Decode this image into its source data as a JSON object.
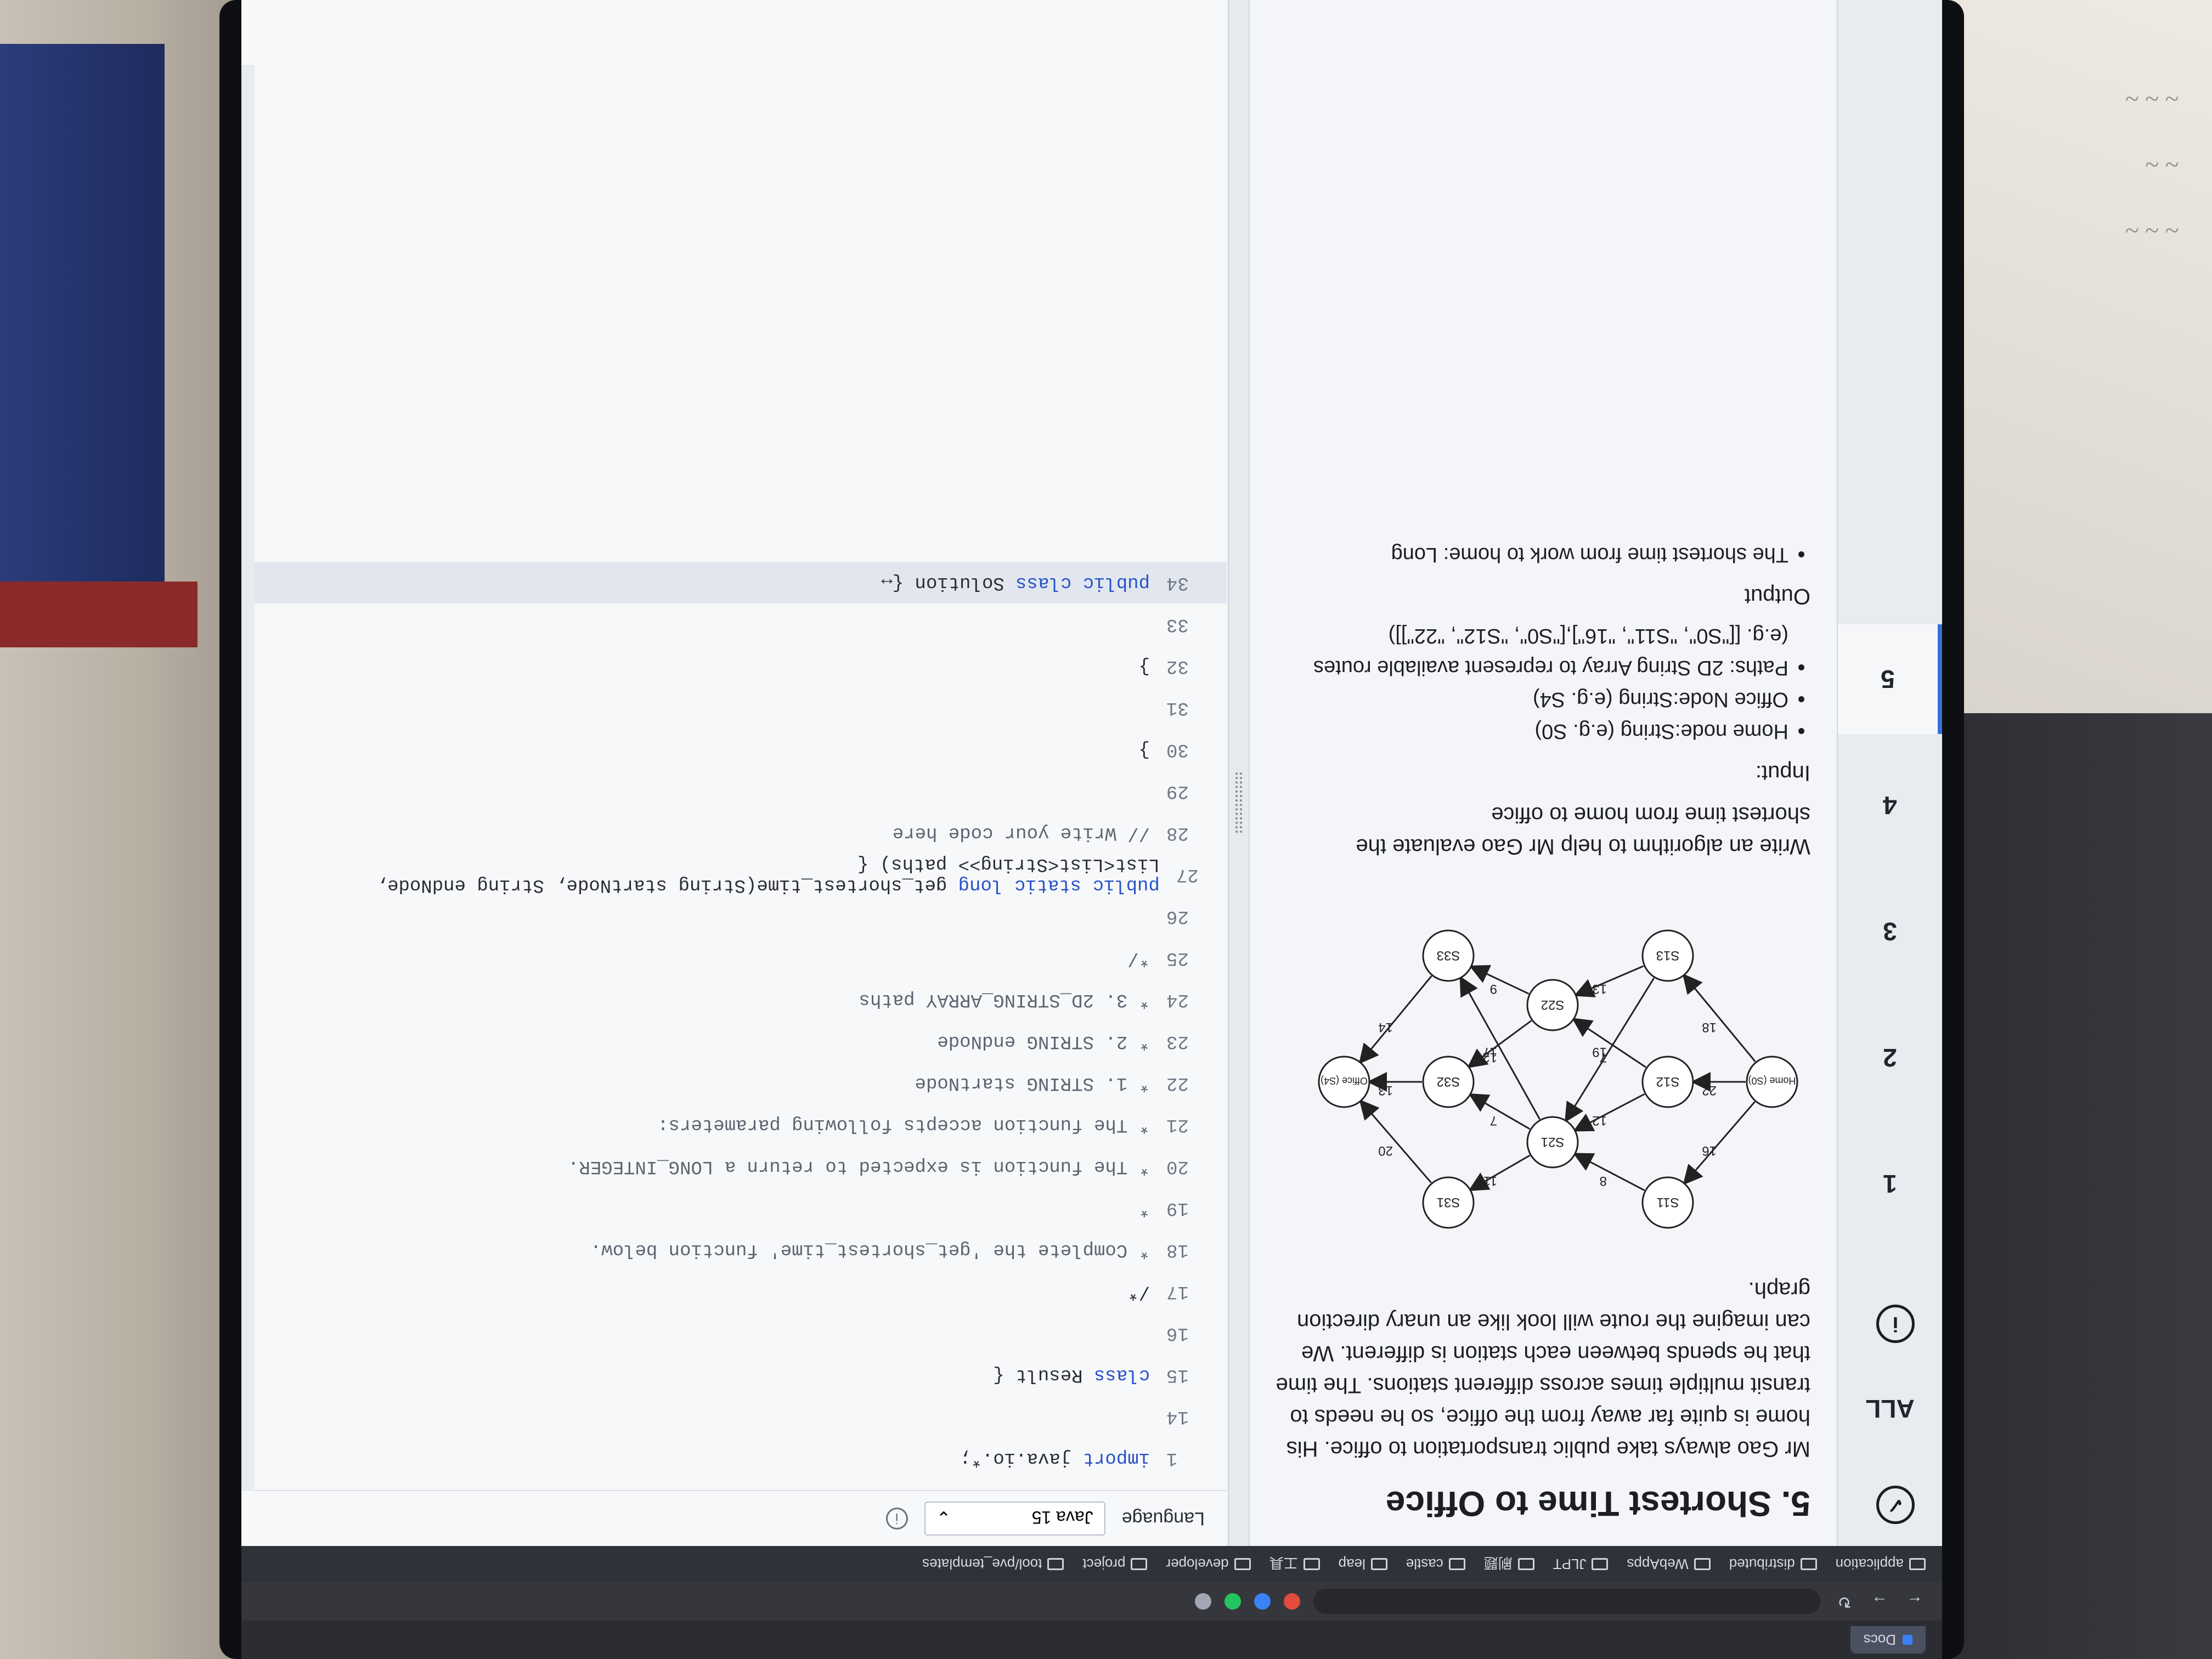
{
  "browser": {
    "tabs": [
      "Docs"
    ],
    "url": "",
    "bookmarks": [
      "application",
      "distributed",
      "WebApps",
      "JLPT",
      "刷题",
      "castle",
      "leap",
      "工具",
      "developer",
      "project",
      "tool/pve_templates"
    ]
  },
  "nav": {
    "all_label": "ALL",
    "info_icon": "i",
    "items": [
      "1",
      "2",
      "3",
      "4",
      "5"
    ],
    "selected": "5"
  },
  "question": {
    "title": "5. Shortest Time to Office",
    "intro": "Mr Gao always take public transportation to office. His home is quite far away from the office, so he needs to transit multiple times across different stations. The time that he spends between each station is different. We can imagine the route will look like an unary direction graph.",
    "task": "Write an algorithm to help Mr Gao evaluate the shortest time from home to office",
    "input_label": "Input:",
    "inputs": [
      "Home node:String (e.g. S0)",
      "Office Node:String (e.g. S4)",
      "Paths: 2D String Array to represent available routes (e.g. [[\"S0\", \"S11\", \"16\"],[\"S0\", \"S12\", \"22\"]])"
    ],
    "output_label": "Output",
    "outputs": [
      "The shortest time from work to home: Long"
    ]
  },
  "graph": {
    "nodes": [
      "Home (S0)",
      "S11",
      "S12",
      "S13",
      "S21",
      "S22",
      "S31",
      "S32",
      "S33",
      "Office (S4)"
    ],
    "edge_labels": [
      "16",
      "22",
      "18",
      "8",
      "12",
      "19",
      "13",
      "11",
      "7",
      "17",
      "9",
      "12",
      "20",
      "13",
      "14",
      "7"
    ]
  },
  "editor": {
    "language_label": "Language",
    "language_value": "Java 15",
    "lines": [
      {
        "n": "1",
        "html": "<span class='kw'>import</span> java.io.*;"
      },
      {
        "n": "14",
        "html": ""
      },
      {
        "n": "15",
        "html": "<span class='kw'>class</span> Result {"
      },
      {
        "n": "16",
        "html": ""
      },
      {
        "n": "17",
        "html": "    /*"
      },
      {
        "n": "18",
        "html": "<span class='cm'>     * Complete the 'get_shortest_time' function below.</span>"
      },
      {
        "n": "19",
        "html": "<span class='cm'>     *</span>"
      },
      {
        "n": "20",
        "html": "<span class='cm'>     * The function is expected to return a LONG_INTEGER.</span>"
      },
      {
        "n": "21",
        "html": "<span class='cm'>     * The function accepts following parameters:</span>"
      },
      {
        "n": "22",
        "html": "<span class='cm'>     *  1. STRING startNode</span>"
      },
      {
        "n": "23",
        "html": "<span class='cm'>     *  2. STRING endNode</span>"
      },
      {
        "n": "24",
        "html": "<span class='cm'>     *  3. 2D_STRING_ARRAY paths</span>"
      },
      {
        "n": "25",
        "html": "<span class='cm'>     */</span>"
      },
      {
        "n": "26",
        "html": ""
      },
      {
        "n": "27",
        "html": "    <span class='kw'>public static long</span> get_shortest_time(String startNode, String endNode, List&lt;List&lt;String&gt;&gt; paths) {"
      },
      {
        "n": "28",
        "html": "<span class='cm'>    // Write your code here</span>"
      },
      {
        "n": "29",
        "html": ""
      },
      {
        "n": "30",
        "html": "    }"
      },
      {
        "n": "31",
        "html": ""
      },
      {
        "n": "32",
        "html": "}"
      },
      {
        "n": "33",
        "html": ""
      },
      {
        "n": "34",
        "html": "<span class='kw'>public class</span> Solution {↔"
      }
    ]
  },
  "colors": {
    "accent": "#3a6ed8",
    "keyword": "#2752c9"
  }
}
